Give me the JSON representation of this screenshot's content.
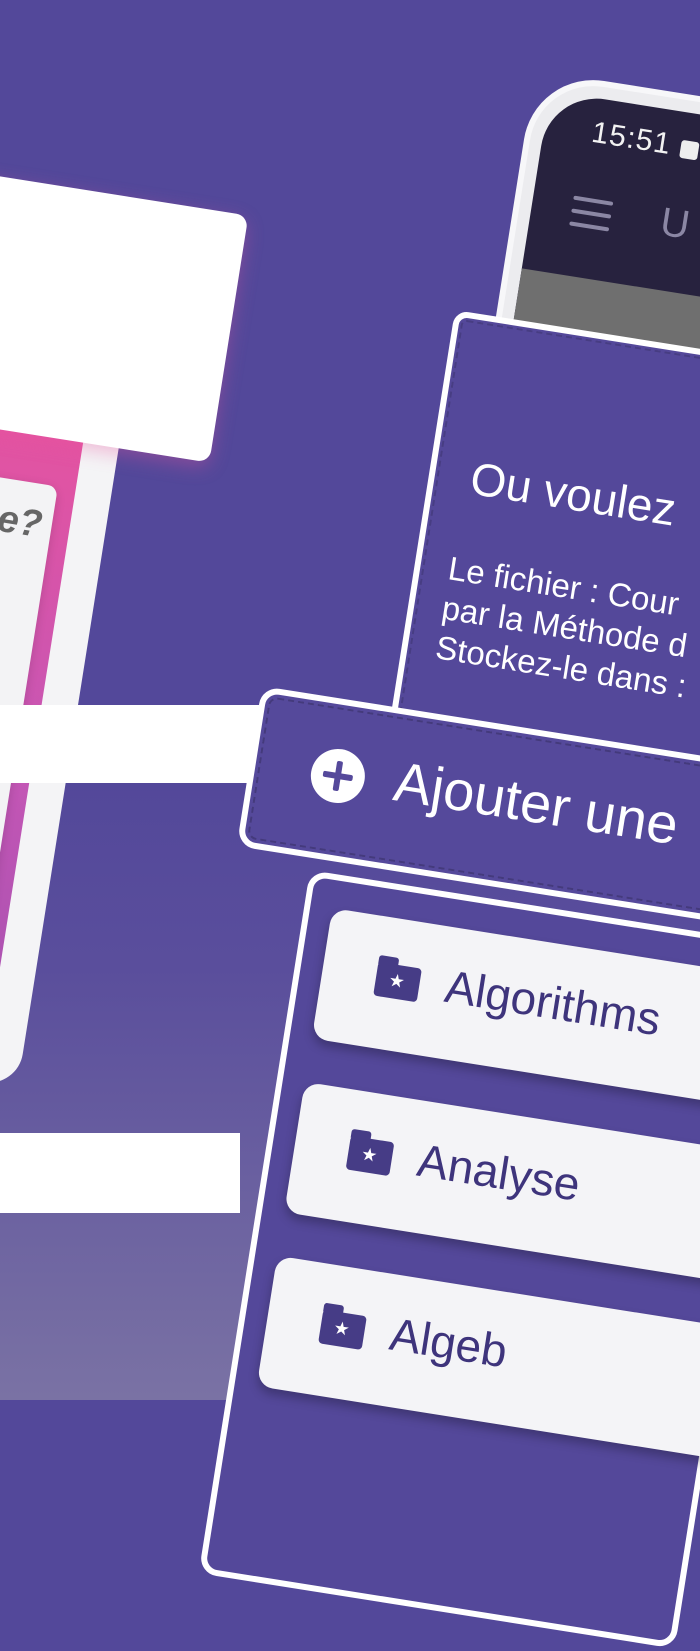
{
  "status_bar": {
    "time": "15:51"
  },
  "app_bar": {
    "title_partial": "U"
  },
  "left_panel": {
    "question_fragment": "e?"
  },
  "dialog": {
    "title": "Ou voulez",
    "body_lines": [
      "Le fichier : Cour",
      "par la Méthode d",
      "Stockez-le dans :"
    ]
  },
  "add_folder": {
    "label": "Ajouter une"
  },
  "folders": [
    {
      "name": "Algorithms",
      "icon": "folder-star-icon"
    },
    {
      "name": "Analyse",
      "icon": "folder-star-icon"
    },
    {
      "name": "Algeb",
      "icon": "folder-star-icon"
    }
  ],
  "colors": {
    "background": "#53489a",
    "panel": "#54489a",
    "accent_pink": "#e7539f",
    "card": "#f4f4f7",
    "folder_text": "#3e347c"
  }
}
